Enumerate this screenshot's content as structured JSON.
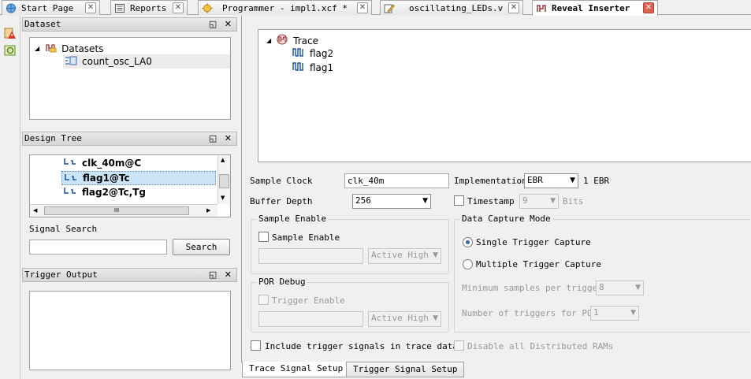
{
  "tabs": [
    {
      "label": "Start Page",
      "icon": "globe-icon"
    },
    {
      "label": "Reports",
      "icon": "report-icon"
    },
    {
      "label": "Programmer - impl1.xcf *",
      "icon": "chip-icon"
    },
    {
      "label": "oscillating_LEDs.v",
      "icon": "pencil-icon"
    },
    {
      "label": "Reveal Inserter",
      "icon": "reveal-icon"
    }
  ],
  "dataset_panel": {
    "title": "Dataset",
    "root": "Datasets",
    "child": "count_osc_LA0"
  },
  "design_tree_panel": {
    "title": "Design Tree",
    "items": [
      "clk_40m@C",
      "flag1@Tc",
      "flag2@Tc,Tg"
    ],
    "signal_search_label": "Signal Search",
    "search_value": "",
    "search_button": "Search",
    "scroll_mark": "III"
  },
  "trigger_output_panel": {
    "title": "Trigger Output"
  },
  "trace_tree": {
    "root": "Trace",
    "signals": [
      "flag2",
      "flag1"
    ]
  },
  "settings": {
    "sample_clock_label": "Sample Clock",
    "sample_clock_value": "clk_40m",
    "implementation_label": "Implementation",
    "implementation_value": "EBR",
    "implementation_count": "1 EBR",
    "buffer_depth_label": "Buffer Depth",
    "buffer_depth_value": "256",
    "timestamp_label": "Timestamp",
    "timestamp_value": "9",
    "timestamp_unit": "Bits",
    "sample_enable_group": "Sample Enable",
    "sample_enable_checkbox": "Sample Enable",
    "sample_enable_polarity": "Active High",
    "por_debug_group": "POR Debug",
    "trigger_enable_checkbox": "Trigger Enable",
    "por_polarity": "Active High",
    "data_capture_group": "Data Capture Mode",
    "single_trigger": "Single Trigger Capture",
    "multiple_trigger": "Multiple Trigger Capture",
    "min_samples_label": "Minimum samples per trigger",
    "min_samples_value": "8",
    "num_triggers_label": "Number of triggers for POR",
    "num_triggers_value": "1",
    "include_trigger_signals": "Include trigger signals in trace data",
    "disable_distributed_rams": "Disable all Distributed RAMs"
  },
  "bottom_tabs": [
    "Trace Signal Setup",
    "Trigger Signal Setup"
  ],
  "panel_buttons": "◱ ✕",
  "colors": {
    "selection": "#cce4f7",
    "reveal_close": "#e06050",
    "signal_icon": "#1a4fa0"
  }
}
